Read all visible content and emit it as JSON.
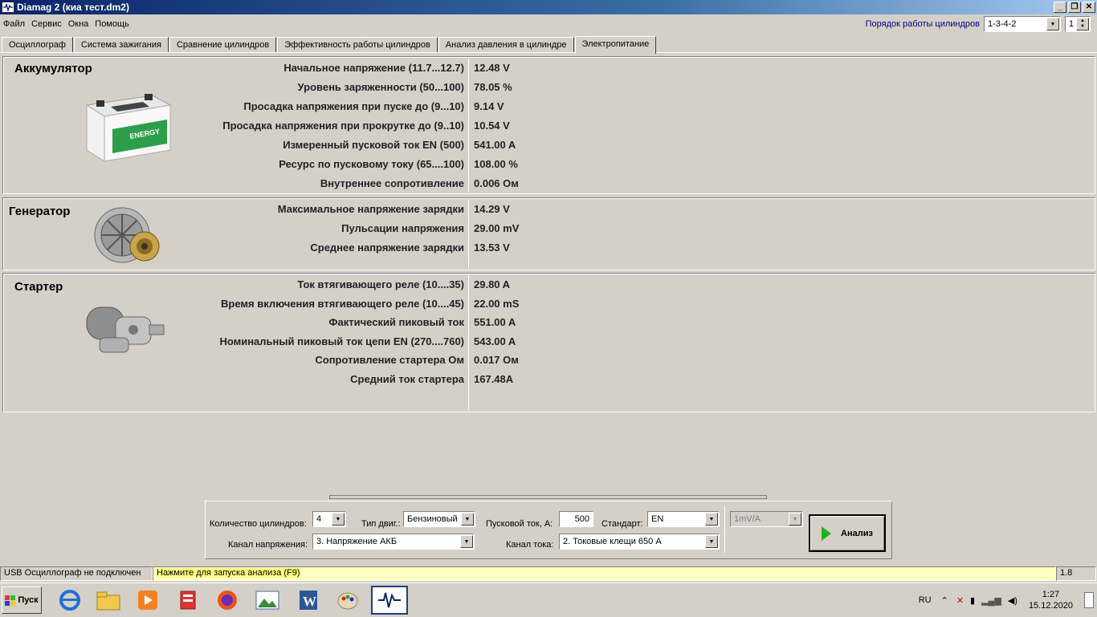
{
  "window": {
    "title": "Diamag 2 (киа тест.dm2)"
  },
  "menu": [
    "Файл",
    "Сервис",
    "Окна",
    "Помощь"
  ],
  "cylinder_order": {
    "label": "Порядок работы цилиндров",
    "value": "1-3-4-2",
    "spin_value": "1"
  },
  "tabs": [
    "Осциллограф",
    "Система зажигания",
    "Сравнение цилиндров",
    "Эффективность работы цилиндров",
    "Анализ давления в цилиндре",
    "Электропитание"
  ],
  "battery": {
    "title": "Аккумулятор",
    "rows": [
      {
        "label": "Начальное напряжение (11.7...12.7)",
        "value": "12.48 V"
      },
      {
        "label": "Уровень заряженности (50...100)",
        "value": "78.05 %"
      },
      {
        "label": "Просадка напряжения при пуске до (9...10)",
        "value": "9.14 V"
      },
      {
        "label": "Просадка напряжения при прокрутке до  (9..10)",
        "value": "10.54 V"
      },
      {
        "label": "Измеренный пусковой ток  EN (500)",
        "value": "541.00 A"
      },
      {
        "label": "Ресурс по пусковому току (65....100)",
        "value": "108.00 %"
      },
      {
        "label": "Внутреннее сопротивление",
        "value": "0.006 Ом"
      }
    ]
  },
  "generator": {
    "title": "Генератор",
    "rows": [
      {
        "label": "Максимальное напряжение зарядки ",
        "value": "14.29 V"
      },
      {
        "label": "Пульсации напряжения",
        "value": "29.00 mV"
      },
      {
        "label": "Среднее напряжение зарядки",
        "value": "13.53 V"
      }
    ]
  },
  "starter": {
    "title": "Стартер",
    "rows": [
      {
        "label": "Ток втягивающего реле (10....35)",
        "value": "29.80 A"
      },
      {
        "label": "Время включения втягивающего реле (10....45)",
        "value": "22.00 mS"
      },
      {
        "label": "Фактический пиковый ток ",
        "value": "551.00 A"
      },
      {
        "label": "Номинальный пиковый ток цепи EN (270....760)",
        "value": "543.00 A"
      },
      {
        "label": "Сопротивление стартера Ом",
        "value": "0.017 Ом"
      },
      {
        "label": "Средний ток стартера",
        "value": "167.48A"
      }
    ]
  },
  "settings": {
    "cyl_count_label": "Количество цилиндров:",
    "cyl_count": "4",
    "engine_type_label": "Тип двиг.:",
    "engine_type": "Бензиновый",
    "start_current_label": "Пусковой ток, А:",
    "start_current": "500",
    "standard_label": "Стандарт:",
    "standard": "EN",
    "scale": "1mV/A",
    "voltage_channel_label": "Канал напряжения:",
    "voltage_channel": "3.  Напряжение АКБ",
    "current_channel_label": "Канал тока:",
    "current_channel": "2.  Токовые клещи 650 A",
    "analyze_label": "Анализ"
  },
  "status": {
    "usb": "USB Осциллограф не подключен",
    "hint": "Нажмите для запуска анализа (F9)",
    "version": "1.8"
  },
  "taskbar": {
    "start": "Пуск",
    "lang": "RU",
    "time": "1:27",
    "date": "15.12.2020"
  },
  "colors": {
    "title_start": "#0a246a",
    "hint_bg": "#ffffc0",
    "link": "#00008b"
  }
}
